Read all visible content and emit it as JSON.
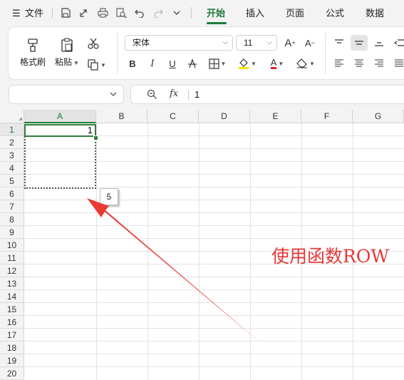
{
  "menu": {
    "hamburger_icon": "menu-lines-icon",
    "file_label": "文件",
    "tabs": [
      {
        "label": "开始",
        "active": true
      },
      {
        "label": "插入",
        "active": false
      },
      {
        "label": "页面",
        "active": false
      },
      {
        "label": "公式",
        "active": false
      },
      {
        "label": "数据",
        "active": false
      }
    ],
    "accent_color": "#1e7a3a"
  },
  "ribbon": {
    "format_painter_label": "格式刷",
    "paste_label": "粘贴",
    "font_name": "宋体",
    "font_size": "11",
    "increase_font_label": "A",
    "decrease_font_label": "A",
    "bold_label": "B",
    "italic_label": "I",
    "underline_label": "U",
    "font_color_label": "A",
    "highlight_color": "#f5e500",
    "font_color": "#e02020"
  },
  "formula_bar": {
    "name_box_value": "",
    "fx_label": "fx",
    "formula_value": "1"
  },
  "sheet": {
    "columns": [
      "A",
      "B",
      "C",
      "D",
      "E",
      "F",
      "G"
    ],
    "rows": [
      "1",
      "2",
      "3",
      "4",
      "5",
      "6",
      "7",
      "8",
      "9",
      "10",
      "11",
      "12",
      "13",
      "14",
      "15",
      "16",
      "17",
      "18",
      "19",
      "20"
    ],
    "active_cell_value": "1",
    "fill_tooltip": "5"
  },
  "annotation": {
    "text": "使用函数ROW",
    "color": "#e53935"
  }
}
